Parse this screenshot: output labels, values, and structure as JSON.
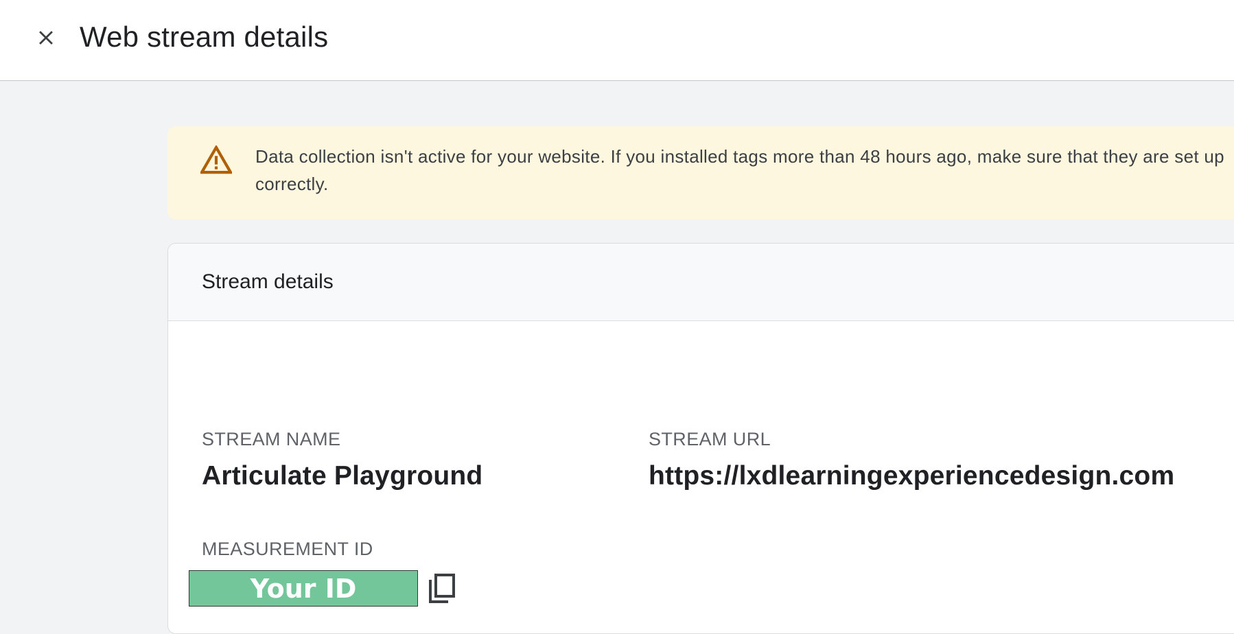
{
  "header": {
    "title": "Web stream details",
    "close_icon": "close-icon"
  },
  "banner": {
    "icon": "warning-icon",
    "icon_color": "#b06000",
    "background": "#fef7e0",
    "message": "Data collection isn't active for your website. If you installed tags more than 48 hours ago, make sure that they are set up correctly."
  },
  "stream_details": {
    "title": "Stream details",
    "stream_name_label": "STREAM NAME",
    "stream_name": "Articulate Playground",
    "stream_url_label": "STREAM URL",
    "stream_url": "https://lxdlearningexperiencedesign.com",
    "measurement_id_label": "MEASUREMENT ID",
    "measurement_id": "Your ID",
    "measurement_id_bg": "#72c69a",
    "copy_icon": "copy-icon"
  }
}
